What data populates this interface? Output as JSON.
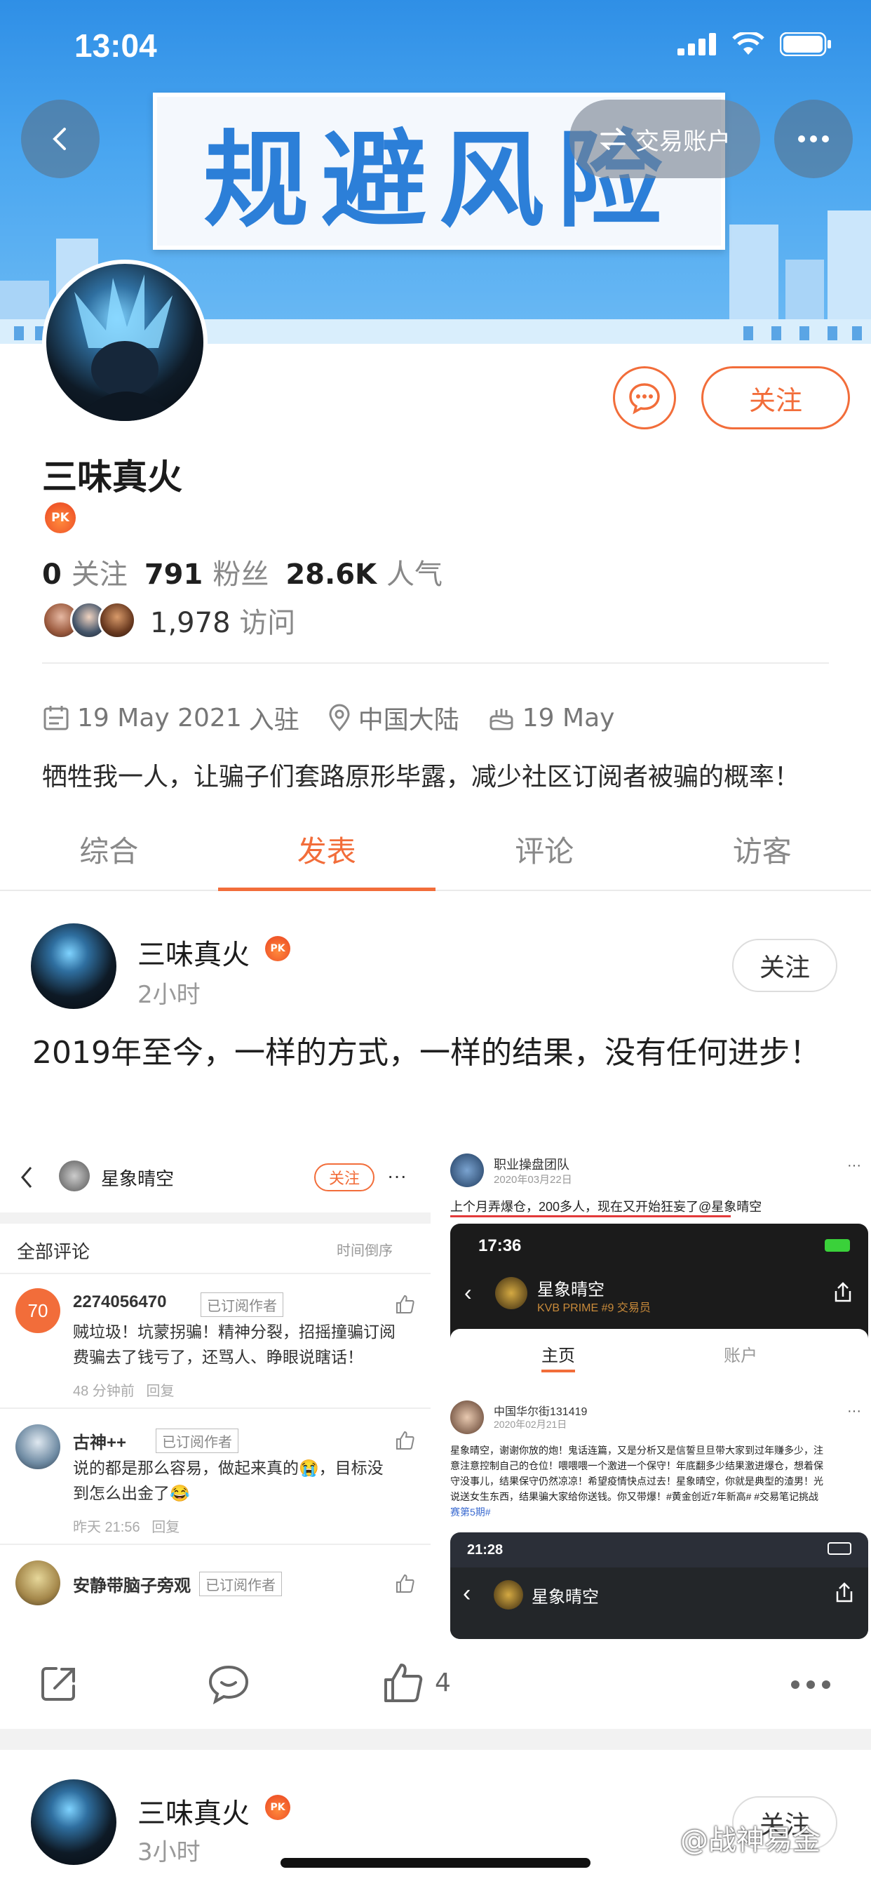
{
  "status_bar": {
    "time": "13:04",
    "battery_icon": "battery-icon",
    "wifi_icon": "wifi-icon",
    "signal_icon": "signal-icon"
  },
  "banner": {
    "sign_text": "规避风险",
    "trade_account_label": "交易账户"
  },
  "profile": {
    "name": "三味真火",
    "badge": "PK",
    "following_count": "0",
    "following_label": "关注",
    "fans_count": "791",
    "fans_label": "粉丝",
    "popularity_count": "28.6K",
    "popularity_label": "人气",
    "visits_count": "1,978",
    "visits_label": "访问",
    "join_date": "19 May 2021",
    "join_label": "入驻",
    "location": "中国大陆",
    "birthday": "19 May",
    "bio": "牺牲我一人，让骗子们套路原形毕露，减少社区订阅者被骗的概率！",
    "follow_button": "关注"
  },
  "tabs": [
    {
      "label": "综合",
      "active": false
    },
    {
      "label": "发表",
      "active": true
    },
    {
      "label": "评论",
      "active": false
    },
    {
      "label": "访客",
      "active": false
    }
  ],
  "posts": [
    {
      "author": "三味真火",
      "time": "2小时",
      "follow": "关注",
      "text": "2019年至今，一样的方式，一样的结果，没有任何进步！",
      "like_count": "4",
      "left_image": {
        "header_name": "星象晴空",
        "header_follow": "关注",
        "section_title": "全部评论",
        "sort_label": "时间倒序",
        "comments": [
          {
            "avatar_text": "70",
            "user": "2274056470",
            "tag": "已订阅作者",
            "text_line1": "贼垃圾！坑蒙拐骗！精神分裂，招摇撞骗订阅",
            "text_line2": "费骗去了钱亏了，还骂人、睁眼说瞎话！",
            "time": "48 分钟前",
            "reply": "回复"
          },
          {
            "user": "古神++",
            "tag": "已订阅作者",
            "text_line1": "说的都是那么容易，做起来真的😭，目标没",
            "text_line2": "到怎么出金了😂",
            "time": "昨天 21:56",
            "reply": "回复"
          },
          {
            "user": "安静带脑子旁观",
            "tag": "已订阅作者"
          }
        ]
      },
      "right_top_image": {
        "user": "职业操盘团队",
        "date": "2020年03月22日",
        "text": "上个月弄爆仓，200多人，现在又开始狂妄了@星象晴空",
        "phone_time": "17:36",
        "page_name": "星象晴空",
        "sub_name": "KVB PRIME #9 交易员",
        "tab_home": "主页",
        "tab_account": "账户"
      },
      "right_bottom_image": {
        "user": "中国华尔街131419",
        "date": "2020年02月21日",
        "text_line1": "星象晴空，谢谢你放的炮！鬼话连篇，又是分析又是信誓旦旦带大家到过年赚多少，注",
        "text_line2": "意注意控制自己的仓位！喂喂喂一个激进一个保守！年底翻多少结果激进爆仓，想着保",
        "text_line3": "守没事儿，结果保守仍然凉凉！希望疫情快点过去！星象晴空，你就是典型的渣男！光",
        "text_line4": "说送女生东西，结果骗大家给你送钱。你又带爆！#黄金创近7年新高# #交易笔记挑战",
        "text_line5": "赛第5期#",
        "phone_time": "21:28",
        "page_name": "星象晴空"
      }
    },
    {
      "author": "三味真火",
      "time": "3小时",
      "follow": "关注"
    }
  ],
  "watermark": "@战神易金",
  "colors": {
    "accent": "#f26d3a",
    "banner_blue": "#2f8fe6"
  }
}
